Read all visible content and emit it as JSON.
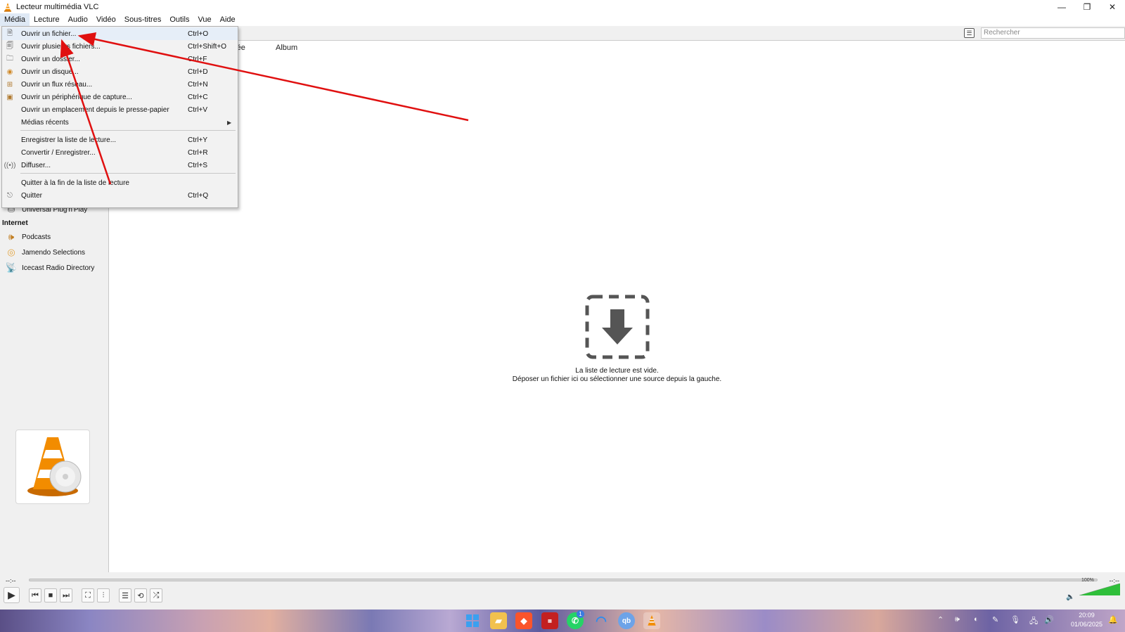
{
  "window": {
    "title": "Lecteur multimédia VLC",
    "minimize": "—",
    "maximize": "❐",
    "close": "✕"
  },
  "menubar": [
    "Média",
    "Lecture",
    "Audio",
    "Vidéo",
    "Sous-titres",
    "Outils",
    "Vue",
    "Aide"
  ],
  "media_menu": {
    "items": [
      {
        "label": "Ouvrir un fichier...",
        "shortcut": "Ctrl+O",
        "icon": "file-icon"
      },
      {
        "label": "Ouvrir plusieurs fichiers...",
        "shortcut": "Ctrl+Shift+O",
        "icon": "files-icon"
      },
      {
        "label": "Ouvrir un dossier...",
        "shortcut": "Ctrl+F",
        "icon": "folder-icon"
      },
      {
        "label": "Ouvrir un disque...",
        "shortcut": "Ctrl+D",
        "icon": "disc-icon"
      },
      {
        "label": "Ouvrir un flux réseau...",
        "shortcut": "Ctrl+N",
        "icon": "network-icon"
      },
      {
        "label": "Ouvrir un périphérique de capture...",
        "shortcut": "Ctrl+C",
        "icon": "capture-icon"
      },
      {
        "label": "Ouvrir un emplacement depuis le presse-papier",
        "shortcut": "Ctrl+V",
        "icon": ""
      },
      {
        "label": "Médias récents",
        "shortcut": "",
        "icon": "",
        "submenu": true
      },
      {
        "label": "Enregistrer la liste de lecture...",
        "shortcut": "Ctrl+Y",
        "icon": ""
      },
      {
        "label": "Convertir / Enregistrer...",
        "shortcut": "Ctrl+R",
        "icon": ""
      },
      {
        "label": "Diffuser...",
        "shortcut": "Ctrl+S",
        "icon": "stream-icon"
      },
      {
        "label": "Quitter à la fin de la liste de lecture",
        "shortcut": "",
        "icon": ""
      },
      {
        "label": "Quitter",
        "shortcut": "Ctrl+Q",
        "icon": "exit-icon"
      }
    ]
  },
  "playlist": {
    "search_placeholder": "Rechercher",
    "columns": [
      "rée",
      "Album"
    ],
    "empty_line1": "La liste de lecture est vide.",
    "empty_line2": "Déposer un fichier ici ou sélectionner une source depuis la gauche."
  },
  "sidebar": {
    "upnp": "Universal Plug'n'Play",
    "internet_header": "Internet",
    "internet_items": [
      "Podcasts",
      "Jamendo Selections",
      "Icecast Radio Directory"
    ]
  },
  "controls": {
    "time_elapsed": "--:--",
    "time_total": "--:--",
    "volume_pct": "100%",
    "volume_level": 1.0
  },
  "taskbar": {
    "time": "20:09",
    "date": "01/06/2025",
    "whatsapp_badge": "1"
  },
  "colors": {
    "vlc_orange": "#f28c00",
    "annotation_red": "#e01010",
    "volume_green": "#2fbf3a"
  }
}
